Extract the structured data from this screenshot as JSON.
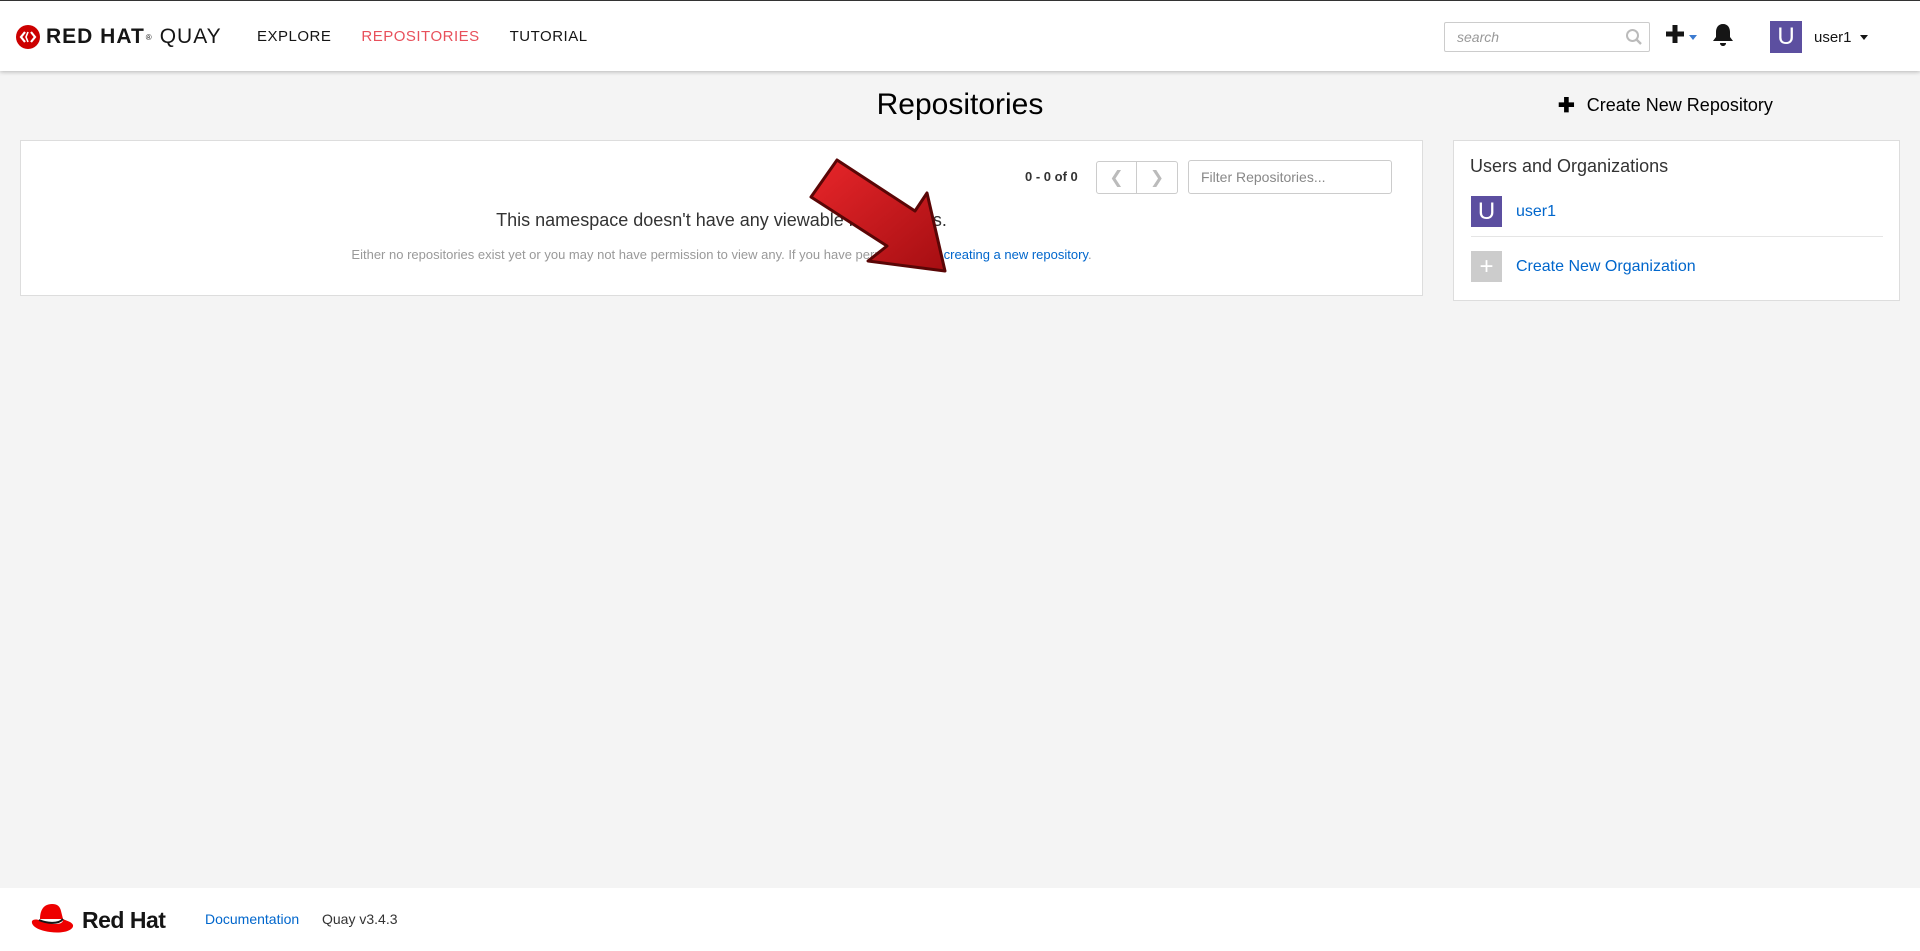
{
  "header": {
    "brand_main": "RED HAT",
    "brand_reg": "®",
    "brand_sub": "QUAY",
    "nav": [
      "EXPLORE",
      "REPOSITORIES",
      "TUTORIAL"
    ],
    "active_nav": "REPOSITORIES",
    "search_placeholder": "search",
    "user": "user1",
    "avatar_letter": "U"
  },
  "main": {
    "title": "Repositories",
    "paging_text": "0 - 0 of 0",
    "pager_prev": "❮",
    "pager_next": "❯",
    "filter_placeholder": "Filter Repositories...",
    "empty_title": "This namespace doesn't have any viewable repositories.",
    "empty_desc": "Either no repositories exist yet or you may not have permission to view any. If you have permission, try ",
    "empty_link": "creating a new repository",
    "empty_desc_end": "."
  },
  "sidebar": {
    "create_repo_plus": "✚",
    "create_repo_label": "Create New Repository",
    "orgs_title": "Users and Organizations",
    "items": [
      {
        "avatar": "U",
        "label": "user1"
      },
      {
        "avatar": "+",
        "label": "Create New Organization"
      }
    ]
  },
  "footer": {
    "logo_text": "Red Hat",
    "documentation": "Documentation",
    "version": "Quay v3.4.3"
  },
  "colors": {
    "accent": "#e8505b",
    "link": "#0066cc",
    "avatar": "#5c4fa0",
    "arrow": "#d0161c"
  }
}
